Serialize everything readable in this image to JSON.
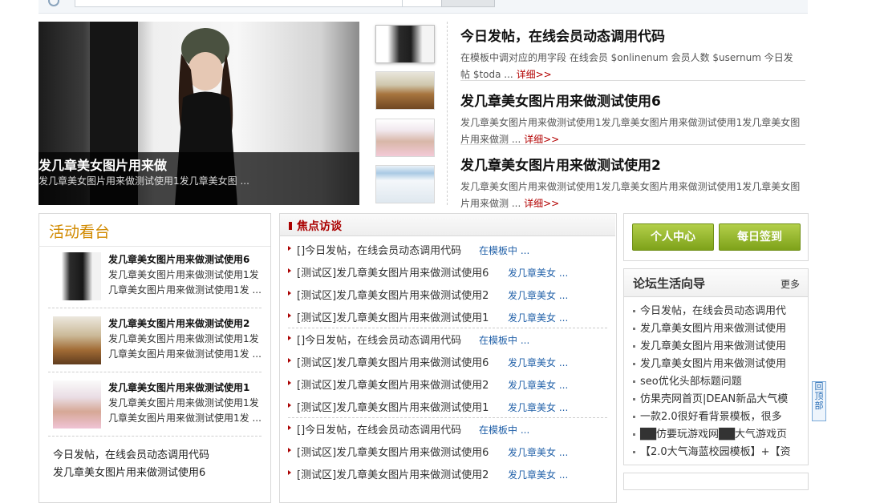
{
  "slideshow": {
    "title": "发几章美女图片用来做",
    "desc": "发几章美女图片用来做测试使用1发几章美女图 ..."
  },
  "headlines": [
    {
      "title": "今日发帖，在线会员动态调用代码",
      "desc": "在模板中调对应的用字段 在线会员 $onlinenum 会员人数 $usernum 今日发帖 $toda ...",
      "more": "详细>>"
    },
    {
      "title": "发几章美女图片用来做测试使用6",
      "desc": "发几章美女图片用来做测试使用1发几章美女图片用来做测试使用1发几章美女图片用来做测 ...",
      "more": "详细>>"
    },
    {
      "title": "发几章美女图片用来做测试使用2",
      "desc": "发几章美女图片用来做测试使用1发几章美女图片用来做测试使用1发几章美女图片用来做测 ...",
      "more": "详细>>"
    }
  ],
  "activity": {
    "title": "活动看台",
    "items": [
      {
        "title": "发几章美女图片用来做测试使用6",
        "desc": "发几章美女图片用来做测试使用1发几章美女图片用来做测试使用1发 ..."
      },
      {
        "title": "发几章美女图片用来做测试使用2",
        "desc": "发几章美女图片用来做测试使用1发几章美女图片用来做测试使用1发 ..."
      },
      {
        "title": "发几章美女图片用来做测试使用1",
        "desc": "发几章美女图片用来做测试使用1发几章美女图片用来做测试使用1发 ..."
      }
    ],
    "links": [
      "今日发帖，在线会员动态调用代码",
      "发几章美女图片用来做测试使用6"
    ]
  },
  "focus": {
    "title": "焦点访谈",
    "rows": [
      {
        "text": "[]今日发帖，在线会员动态调用代码",
        "sub": "在模板中 ..."
      },
      {
        "text": "[测试区]发几章美女图片用来做测试使用6",
        "sub": "发几章美女 ..."
      },
      {
        "text": "[测试区]发几章美女图片用来做测试使用2",
        "sub": "发几章美女 ..."
      },
      {
        "text": "[测试区]发几章美女图片用来做测试使用1",
        "sub": "发几章美女 ..."
      },
      {
        "text": "[]今日发帖，在线会员动态调用代码",
        "sub": "在模板中 ..."
      },
      {
        "text": "[测试区]发几章美女图片用来做测试使用6",
        "sub": "发几章美女 ..."
      },
      {
        "text": "[测试区]发几章美女图片用来做测试使用2",
        "sub": "发几章美女 ..."
      },
      {
        "text": "[测试区]发几章美女图片用来做测试使用1",
        "sub": "发几章美女 ..."
      },
      {
        "text": "[]今日发帖，在线会员动态调用代码",
        "sub": "在模板中 ..."
      },
      {
        "text": "[测试区]发几章美女图片用来做测试使用6",
        "sub": "发几章美女 ..."
      },
      {
        "text": "[测试区]发几章美女图片用来做测试使用2",
        "sub": "发几章美女 ..."
      }
    ]
  },
  "buttons": {
    "personal": "个人中心",
    "signin": "每日签到"
  },
  "guide": {
    "title": "论坛生活向导",
    "more": "更多",
    "items": [
      "今日发帖，在线会员动态调用代",
      "发几章美女图片用来做测试使用",
      "发几章美女图片用来做测试使用",
      "发几章美女图片用来做测试使用",
      "seo优化头部标题问题",
      "仿果壳网首页|DEAN新品大气模",
      "一款2.0很好看背景模板，很多",
      "██仿要玩游戏网██大气游戏页",
      "【2.0大气海蓝校园模板】+【资"
    ]
  },
  "backtop": {
    "label": "回顶部"
  },
  "colors": {
    "accent_red": "#b30000",
    "orange_title": "#d18a00",
    "green_btn": "#8db52a",
    "link_blue": "#2160a8"
  }
}
